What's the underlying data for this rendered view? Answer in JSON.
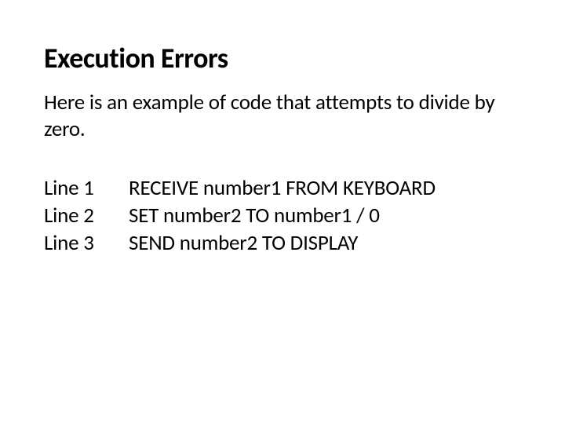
{
  "slide": {
    "title": "Execution Errors",
    "intro": "Here is an example of code that attempts to divide by zero.",
    "code_lines": [
      {
        "label": "Line 1",
        "code": "RECEIVE number1 FROM KEYBOARD"
      },
      {
        "label": "Line 2",
        "code": "SET number2 TO number1 / 0"
      },
      {
        "label": "Line 3",
        "code": "SEND number2 TO DISPLAY"
      }
    ]
  }
}
